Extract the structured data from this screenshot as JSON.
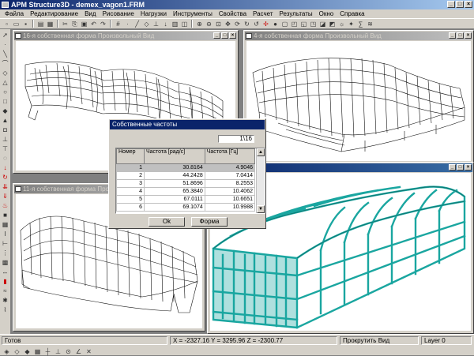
{
  "app": {
    "title": "APM Structure3D - demex_vagon1.FRM"
  },
  "menu": [
    "Файла",
    "Редактирование",
    "Вид",
    "Рисование",
    "Нагрузки",
    "Инструменты",
    "Свойства",
    "Расчет",
    "Результаты",
    "Окно",
    "Справка"
  ],
  "windows": {
    "w16": {
      "title": "16-я собственная форма Произвольный Вид"
    },
    "w4": {
      "title": "4-я собственная форма Произвольный Вид"
    },
    "w11": {
      "title": "11-я собственная форма Произв"
    }
  },
  "dialog": {
    "title": "Собственные частоты",
    "counter": "1\\16",
    "headers": [
      "Номер",
      "Частота [рад/с]",
      "Частота [Гц]"
    ],
    "rows": [
      [
        "1",
        "30.8164",
        "4.9046"
      ],
      [
        "2",
        "44.2428",
        "7.0414"
      ],
      [
        "3",
        "51.8696",
        "8.2553"
      ],
      [
        "4",
        "65.3840",
        "10.4062"
      ],
      [
        "5",
        "67.0111",
        "10.6651"
      ],
      [
        "6",
        "69.1074",
        "10.9988"
      ]
    ],
    "ok_label": "Ok",
    "form_label": "Форма"
  },
  "status": {
    "ready": "Готов",
    "coords": "X = -2327.16 Y = 3295.96 Z = -2300.77",
    "mode": "Прокрутить Вид",
    "layer": "Layer 0"
  },
  "colors": {
    "wire": "#111111",
    "model": "#1aa6a0",
    "title_active": "#0a246a"
  }
}
